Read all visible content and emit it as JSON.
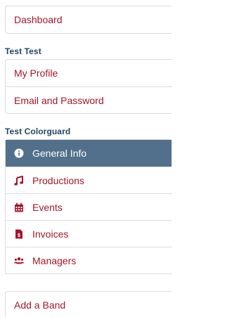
{
  "top": {
    "dashboard_label": "Dashboard"
  },
  "account": {
    "section_title": "Test Test",
    "items": [
      {
        "label": "My Profile"
      },
      {
        "label": "Email and Password"
      }
    ]
  },
  "org": {
    "section_title": "Test Colorguard",
    "items": [
      {
        "label": "General Info",
        "icon": "info-icon",
        "active": true
      },
      {
        "label": "Productions",
        "icon": "music-icon"
      },
      {
        "label": "Events",
        "icon": "calendar-icon"
      },
      {
        "label": "Invoices",
        "icon": "invoice-icon"
      },
      {
        "label": "Managers",
        "icon": "users-icon"
      }
    ]
  },
  "bottom": {
    "add_band_label": "Add a Band"
  },
  "colors": {
    "link": "#a3162a",
    "active_bg": "#52708c",
    "section_title": "#1f4565",
    "border": "#dcdcdc"
  }
}
